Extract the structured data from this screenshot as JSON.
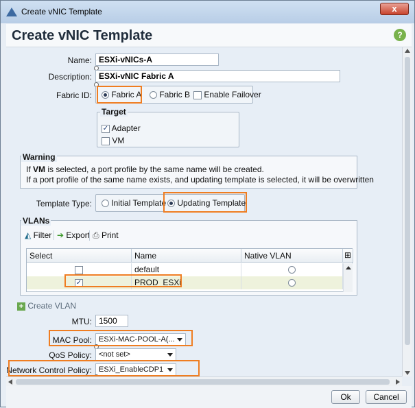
{
  "window": {
    "title": "Create vNIC Template",
    "close_label": "x"
  },
  "header": {
    "title": "Create vNIC Template",
    "help_icon": "help-icon"
  },
  "form": {
    "name_label": "Name:",
    "name_value": "ESXi-vNICs-A",
    "description_label": "Description:",
    "description_value": "ESXi-vNIC Fabric A",
    "fabric_label": "Fabric ID:",
    "fabric_a": "Fabric A",
    "fabric_b": "Fabric B",
    "enable_failover": "Enable Failover",
    "target_legend": "Target",
    "target_adapter": "Adapter",
    "target_vm": "VM",
    "warning_legend": "Warning",
    "warning_line1_a": "If ",
    "warning_line1_vm": "VM",
    "warning_line1_b": " is selected, a port profile by the same name will be created.",
    "warning_line2": "If a port profile of the same name exists, and updating template is selected, it will be overwritten",
    "template_type_label": "Template Type:",
    "template_initial": "Initial Template",
    "template_updating": "Updating Template",
    "vlans_legend": "VLANs",
    "toolbar_filter": "Filter",
    "toolbar_export": "Export",
    "toolbar_print": "Print",
    "table": {
      "headers": [
        "Select",
        "Name",
        "Native VLAN"
      ],
      "rows": [
        {
          "name": "default",
          "selected": false
        },
        {
          "name": "PROD_ESXi",
          "selected": true
        }
      ]
    },
    "create_vlan": "Create VLAN",
    "mtu_label": "MTU:",
    "mtu_value": "1500",
    "mac_pool_label": "MAC Pool:",
    "mac_pool_value": "ESXi-MAC-POOL-A(...",
    "qos_label": "QoS Policy:",
    "qos_value": "<not set>",
    "ncp_label": "Network Control Policy:",
    "ncp_value": "ESXi_EnableCDP1"
  },
  "footer": {
    "ok": "Ok",
    "cancel": "Cancel"
  },
  "colors": {
    "highlight": "#ef7d21",
    "accent": "#3d6aa1"
  }
}
